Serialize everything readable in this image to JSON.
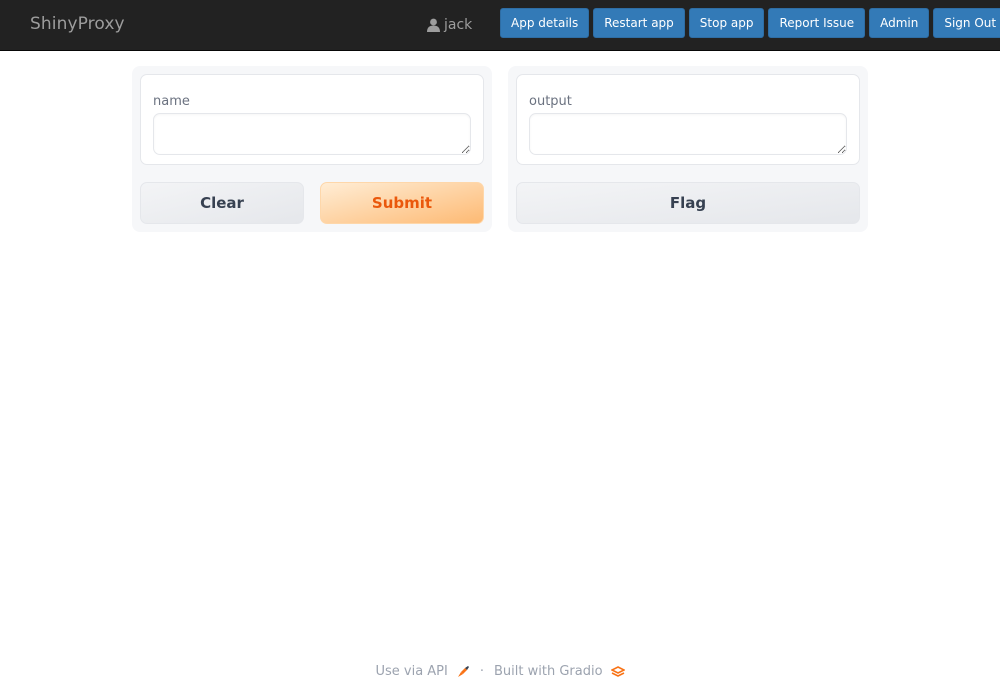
{
  "navbar": {
    "brand": "ShinyProxy",
    "user": {
      "icon": "user-icon",
      "name": "jack"
    },
    "buttons": [
      {
        "label": "App details"
      },
      {
        "label": "Restart app"
      },
      {
        "label": "Stop app"
      },
      {
        "label": "Report Issue"
      },
      {
        "label": "Admin"
      },
      {
        "label": "Sign Out"
      }
    ]
  },
  "input_panel": {
    "field": {
      "label": "name",
      "value": "",
      "placeholder": ""
    },
    "clear_label": "Clear",
    "submit_label": "Submit"
  },
  "output_panel": {
    "field": {
      "label": "output",
      "value": ""
    },
    "flag_label": "Flag"
  },
  "footer": {
    "api_link": "Use via API",
    "api_icon": "rocket-icon",
    "separator": "·",
    "built_with": "Built with Gradio",
    "gradio_icon": "gradio-logo-icon"
  },
  "colors": {
    "navbar_bg": "#222222",
    "nav_button": "#337ab7",
    "primary_text": "#ea580c",
    "primary_gradient_from": "#ffedd5",
    "primary_gradient_to": "#fdba74"
  }
}
